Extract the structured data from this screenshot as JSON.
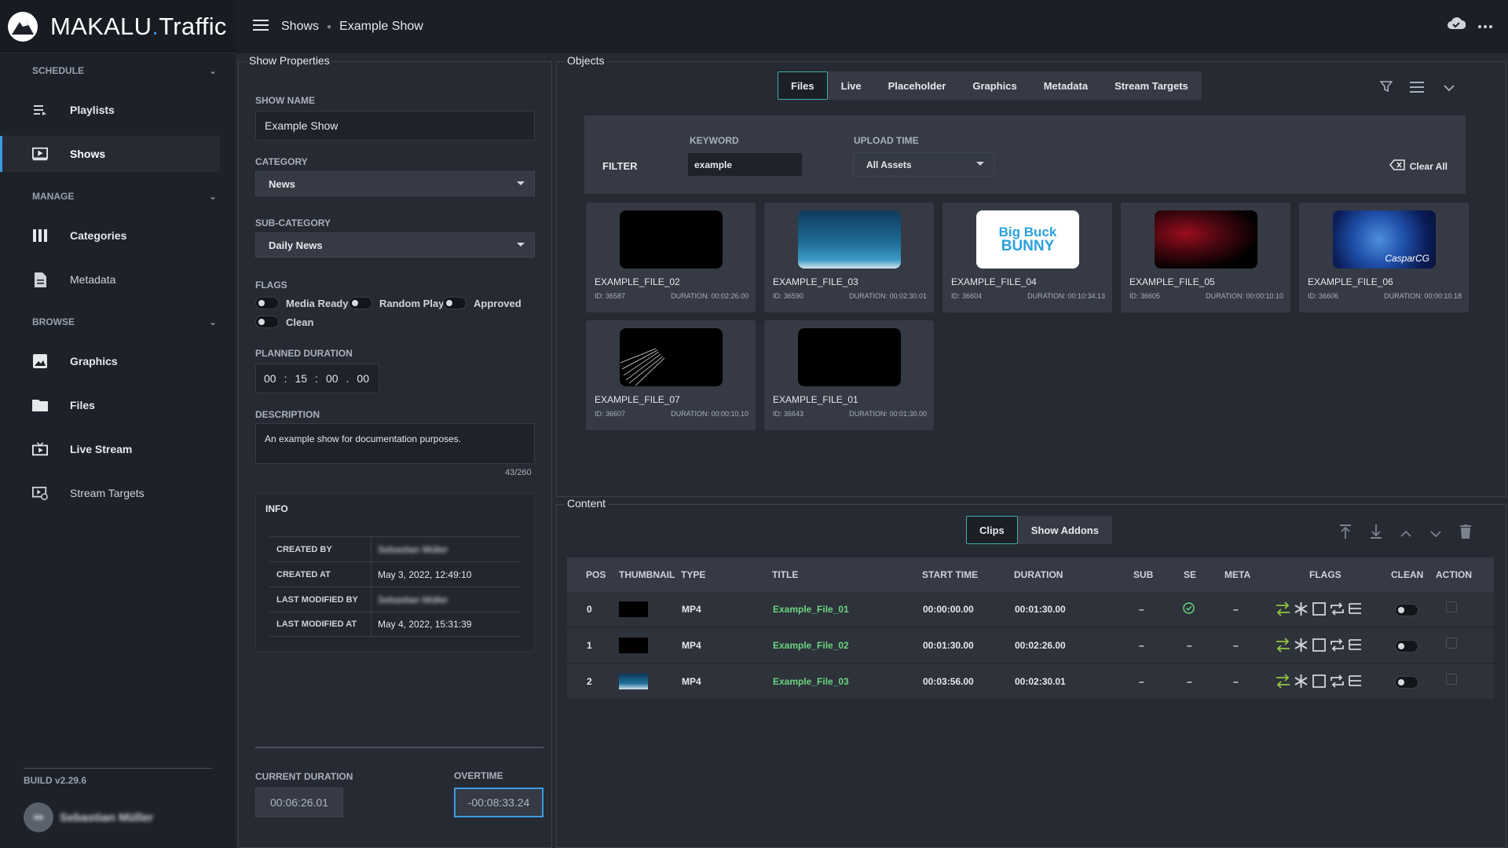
{
  "app": {
    "logo_main": "MAKALU",
    "logo_dot": ".",
    "logo_sub": "Traffic"
  },
  "breadcrumb": {
    "section": "Shows",
    "current": "Example Show"
  },
  "sidebar": {
    "sections": [
      {
        "label": "SCHEDULE"
      },
      {
        "label": "MANAGE"
      },
      {
        "label": "BROWSE"
      }
    ],
    "items": [
      {
        "label": "Playlists",
        "icon": "playlist-icon"
      },
      {
        "label": "Shows",
        "icon": "show-play-icon"
      },
      {
        "label": "Categories",
        "icon": "columns-icon"
      },
      {
        "label": "Metadata",
        "icon": "document-icon"
      },
      {
        "label": "Graphics",
        "icon": "image-icon"
      },
      {
        "label": "Files",
        "icon": "folder-icon"
      },
      {
        "label": "Live Stream",
        "icon": "live-tv-icon"
      },
      {
        "label": "Stream Targets",
        "icon": "stream-settings-icon"
      }
    ],
    "build": "BUILD v2.29.6",
    "user_initials": "■■",
    "user_name": "Sebastian Müller"
  },
  "show_properties": {
    "legend": "Show Properties",
    "show_name_label": "SHOW NAME",
    "show_name": "Example Show",
    "category_label": "CATEGORY",
    "category": "News",
    "subcategory_label": "SUB-CATEGORY",
    "subcategory": "Daily News",
    "flags_label": "FLAGS",
    "flags": [
      "Media Ready",
      "Random Play",
      "Approved",
      "Clean"
    ],
    "planned_label": "PLANNED DURATION",
    "planned": {
      "h": "00",
      "m": "15",
      "s": "00",
      "f": "00",
      "sep1": ":",
      "sep2": ":",
      "sep3": "."
    },
    "description_label": "DESCRIPTION",
    "description": "An example show for documentation purposes.",
    "description_count": "43/260",
    "info": {
      "title": "INFO",
      "rows": [
        {
          "k": "CREATED BY",
          "v": "Sebastian Müller"
        },
        {
          "k": "CREATED AT",
          "v": "May 3, 2022, 12:49:10"
        },
        {
          "k": "LAST MODIFIED BY",
          "v": "Sebastian Müller"
        },
        {
          "k": "LAST MODIFIED AT",
          "v": "May 4, 2022, 15:31:39"
        }
      ]
    },
    "current_duration_label": "CURRENT DURATION",
    "current_duration": "00:06:26.01",
    "overtime_label": "OVERTIME",
    "overtime": "-00:08:33.24"
  },
  "objects": {
    "legend": "Objects",
    "tabs": [
      "Files",
      "Live",
      "Placeholder",
      "Graphics",
      "Metadata",
      "Stream Targets"
    ],
    "active_tab": "Files",
    "filter": {
      "label": "FILTER",
      "keyword_label": "KEYWORD",
      "keyword": "example",
      "upload_label": "UPLOAD TIME",
      "upload": "All Assets",
      "clear": "Clear All"
    },
    "files": [
      {
        "name": "EXAMPLE_FILE_02",
        "id": "ID: 36587",
        "duration": "DURATION: 00:02:26.00",
        "thumb": "black"
      },
      {
        "name": "EXAMPLE_FILE_03",
        "id": "ID: 36590",
        "duration": "DURATION: 00:02:30.01",
        "thumb": "sky"
      },
      {
        "name": "EXAMPLE_FILE_04",
        "id": "ID: 36604",
        "duration": "DURATION: 00:10:34.13",
        "thumb": "bunny",
        "thumb_text1": "Big Buck",
        "thumb_text2": "BUNNY"
      },
      {
        "name": "EXAMPLE_FILE_05",
        "id": "ID: 36605",
        "duration": "DURATION: 00:00:10.10",
        "thumb": "red"
      },
      {
        "name": "EXAMPLE_FILE_06",
        "id": "ID: 36606",
        "duration": "DURATION: 00:00:10.18",
        "thumb": "globe",
        "thumb_text1": "CasparCG"
      },
      {
        "name": "EXAMPLE_FILE_07",
        "id": "ID: 36607",
        "duration": "DURATION: 00:00:10.10",
        "thumb": "streaks"
      },
      {
        "name": "EXAMPLE_FILE_01",
        "id": "ID: 36643",
        "duration": "DURATION: 00:01:30.00",
        "thumb": "black"
      }
    ]
  },
  "content": {
    "legend": "Content",
    "tabs": [
      "Clips",
      "Show Addons"
    ],
    "active_tab": "Clips",
    "columns": [
      "POS",
      "THUMBNAIL",
      "TYPE",
      "TITLE",
      "START TIME",
      "DURATION",
      "SUB",
      "SE",
      "META",
      "FLAGS",
      "CLEAN",
      "ACTION"
    ],
    "rows": [
      {
        "pos": "0",
        "type": "MP4",
        "title": "Example_File_01",
        "start": "00:00:00.00",
        "duration": "00:01:30.00",
        "sub": "–",
        "se": "check",
        "meta": "–",
        "thumb": "black"
      },
      {
        "pos": "1",
        "type": "MP4",
        "title": "Example_File_02",
        "start": "00:01:30.00",
        "duration": "00:02:26.00",
        "sub": "–",
        "se": "–",
        "meta": "–",
        "thumb": "black"
      },
      {
        "pos": "2",
        "type": "MP4",
        "title": "Example_File_03",
        "start": "00:03:56.00",
        "duration": "00:02:30.01",
        "sub": "–",
        "se": "–",
        "meta": "–",
        "thumb": "sky"
      }
    ]
  },
  "colors": {
    "accent_teal": "#3ab0a8",
    "green_title": "#6bd47d",
    "blue": "#3b9be0"
  }
}
